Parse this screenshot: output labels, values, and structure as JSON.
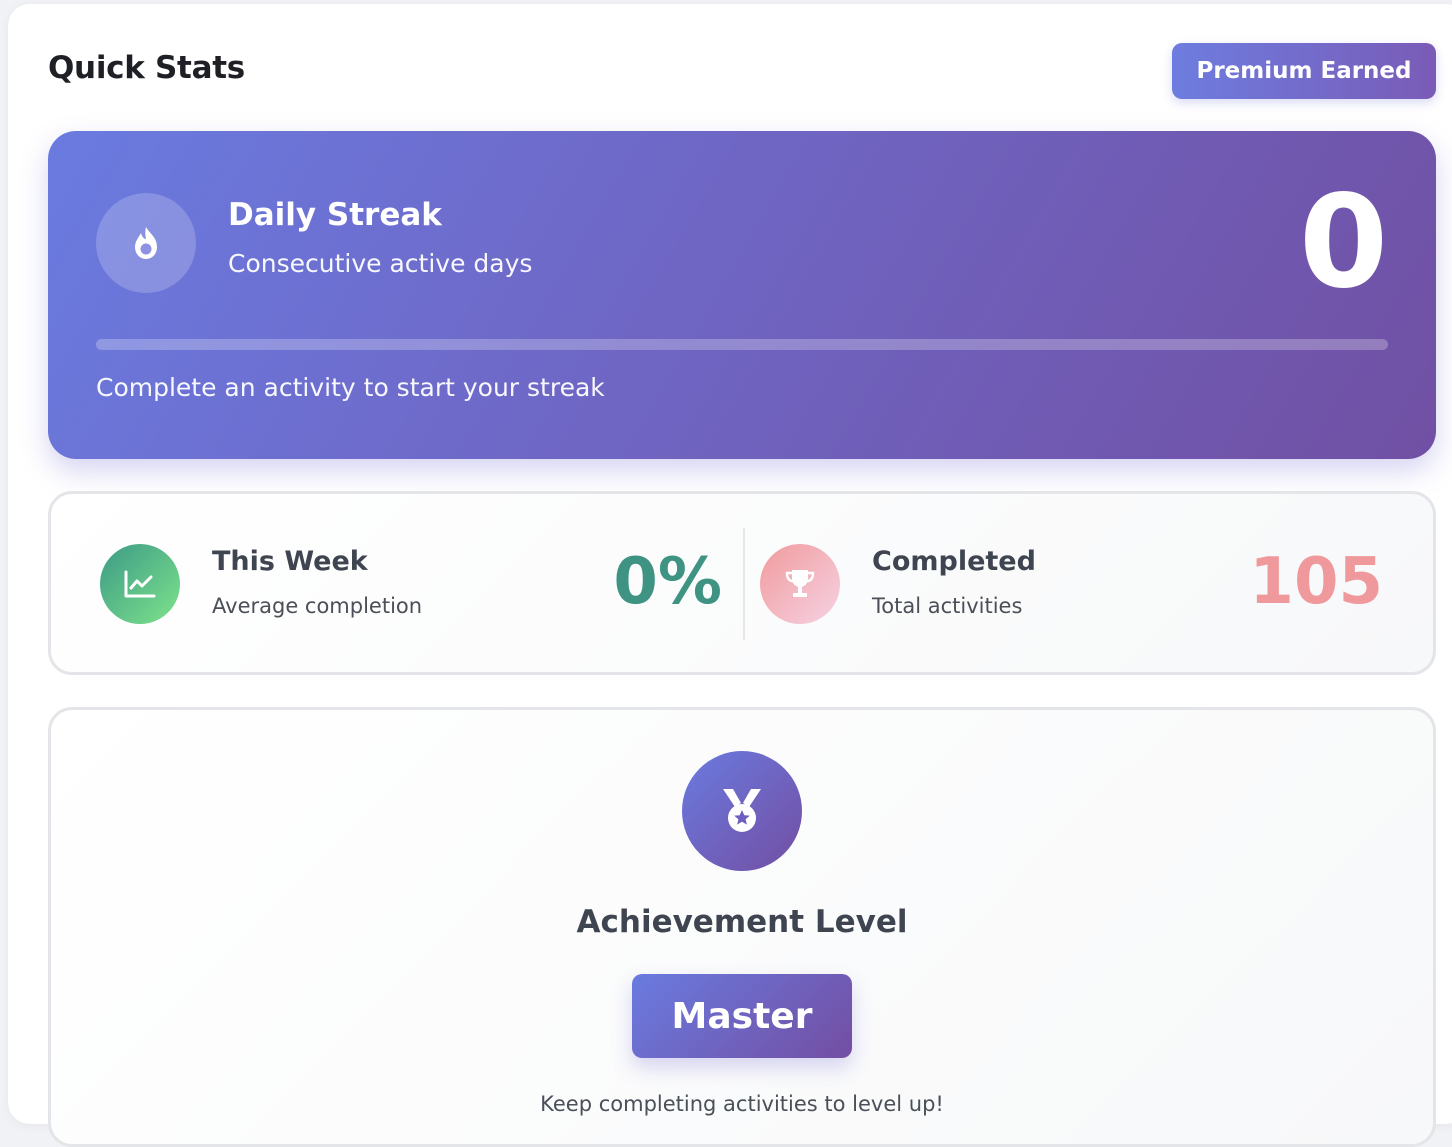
{
  "header": {
    "title": "Quick Stats",
    "badge_label": "Premium Earned"
  },
  "streak": {
    "icon": "flame-icon",
    "title": "Daily Streak",
    "subtitle": "Consecutive active days",
    "value": "0",
    "progress": 0,
    "message": "Complete an activity to start your streak"
  },
  "stats": {
    "week": {
      "icon": "chart-line-icon",
      "title": "This Week",
      "subtitle": "Average completion",
      "value": "0%"
    },
    "completed": {
      "icon": "trophy-icon",
      "title": "Completed",
      "subtitle": "Total activities",
      "value": "105"
    }
  },
  "achievement": {
    "icon": "medal-icon",
    "title": "Achievement Level",
    "level": "Master",
    "message": "Keep completing activities to level up!"
  },
  "colors": {
    "accent_start": "#6a7be0",
    "accent_end": "#734ea2",
    "green": "#3f9383",
    "pink": "#f0999c"
  }
}
